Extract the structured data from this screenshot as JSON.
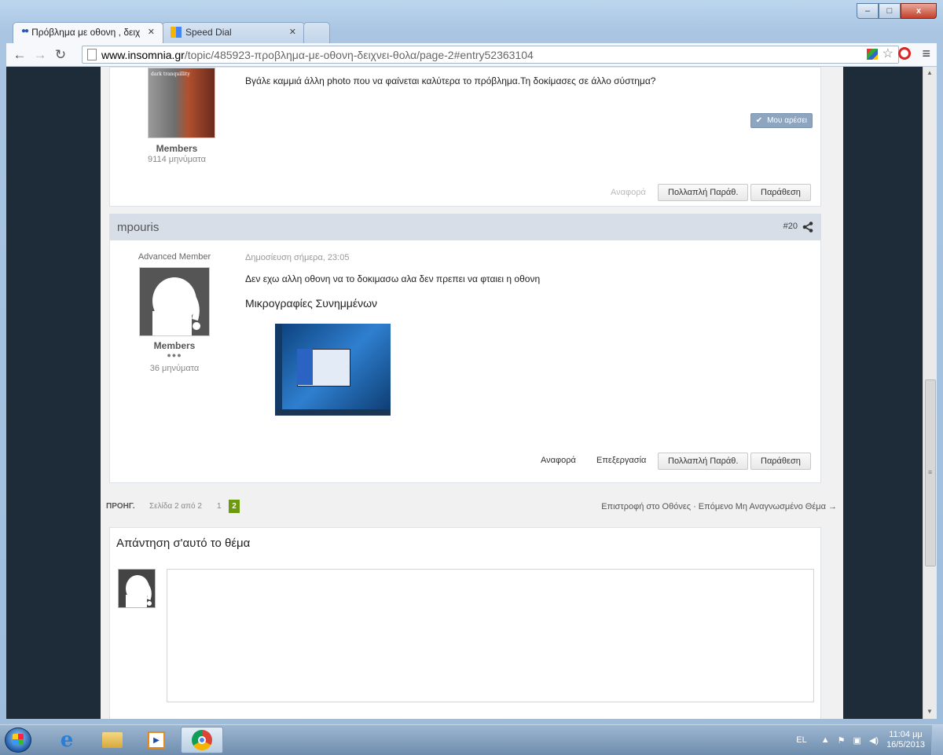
{
  "browser": {
    "tabs": [
      {
        "title": "Πρόβλημα με οθονη , δειχ",
        "active": true
      },
      {
        "title": "Speed Dial",
        "active": false
      }
    ],
    "url_host": "www.insomnia.gr",
    "url_path": "/topic/485923-προβλημα-με-οθονη-δειχνει-θολα/page-2#entry52363104",
    "window_controls": {
      "minimize": "–",
      "maximize": "□",
      "close": "x"
    }
  },
  "post_prev": {
    "album_label": "dark tranquillity",
    "group": "Members",
    "count": "9114 μηνύματα",
    "text": "Βγάλε καμμιά άλλη photo που να φαίνεται καλύτερα το πρόβλημα.Τη δοκίμασες σε άλλο σύστημα?",
    "like_label": "Μου αρέσει",
    "report_label": "Αναφορά",
    "multiquote_label": "Πολλαπλή Παράθ.",
    "quote_label": "Παράθεση"
  },
  "post": {
    "username": "mpouris",
    "number": "#20",
    "rank": "Advanced Member",
    "date": "Δημοσίευση σήμερα, 23:05",
    "text": "Δεν εχω αλλη οθονη να το δοκιμασω αλα δεν πρεπει να φταιει η οθονη",
    "attach_title": "Μικρογραφίες Συνημμένων",
    "group": "Members",
    "pips": "●●●",
    "count": "36 μηνύματα",
    "report_label": "Αναφορά",
    "edit_label": "Επεξεργασία",
    "multiquote_label": "Πολλαπλή Παράθ.",
    "quote_label": "Παράθεση"
  },
  "pager": {
    "prev_label": "ΠΡΟΗΓ.",
    "page_of": "Σελίδα 2 από 2",
    "pages": [
      "1",
      "2"
    ],
    "right_links": "Επιστροφή στο Οθόνες · Επόμενο Μη Αναγνωσμένο Θέμα →"
  },
  "reply": {
    "title": "Απάντηση σ'αυτό το θέμα"
  },
  "taskbar": {
    "lang": "EL",
    "time": "11:04 μμ",
    "date": "16/5/2013"
  },
  "colors": {
    "page_bg": "#f1f1f1",
    "post_header_bg": "#d8dee8",
    "pager_active": "#6b9a0e",
    "like_button": "#8ea5bf"
  }
}
